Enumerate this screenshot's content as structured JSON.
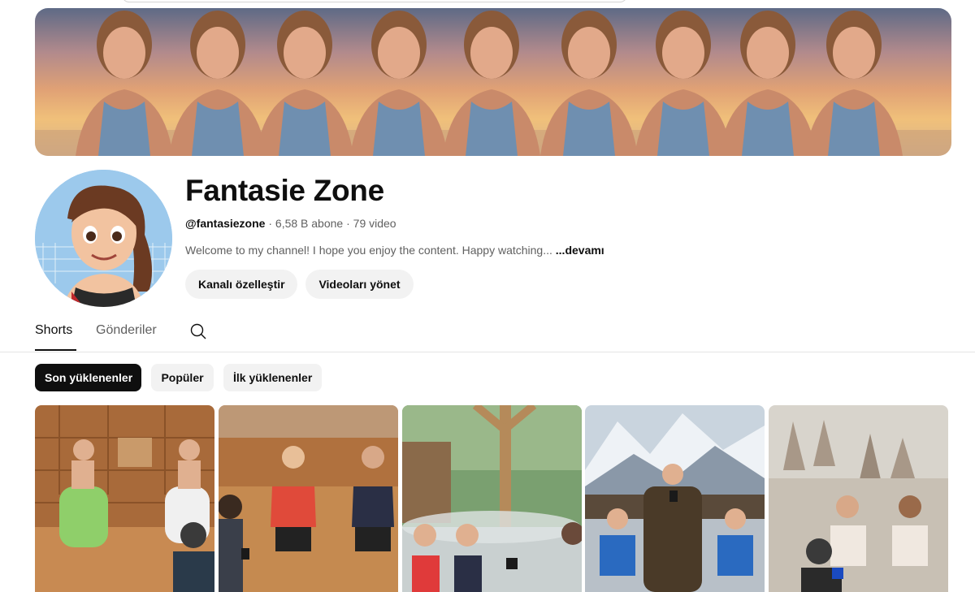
{
  "channel": {
    "name": "Fantasie Zone",
    "handle": "@fantasiezone",
    "subscribers": "6,58 B abone",
    "video_count": "79 video",
    "separator": "·",
    "description": "Welcome to my channel! I hope you enjoy the content. Happy watching...",
    "more_label": "...devamı"
  },
  "actions": {
    "customize_label": "Kanalı özelleştir",
    "manage_label": "Videoları yönet"
  },
  "tabs": [
    {
      "label": "Shorts",
      "active": true
    },
    {
      "label": "Gönderiler",
      "active": false
    }
  ],
  "filters": [
    {
      "label": "Son yüklenenler",
      "selected": true
    },
    {
      "label": "Popüler",
      "selected": false
    },
    {
      "label": "İlk yüklenenler",
      "selected": false
    }
  ],
  "thumbnails": [
    {
      "scene": "sauna"
    },
    {
      "scene": "sauna-interview"
    },
    {
      "scene": "hot-spring"
    },
    {
      "scene": "snow-mountain"
    },
    {
      "scene": "rock-formations"
    }
  ]
}
